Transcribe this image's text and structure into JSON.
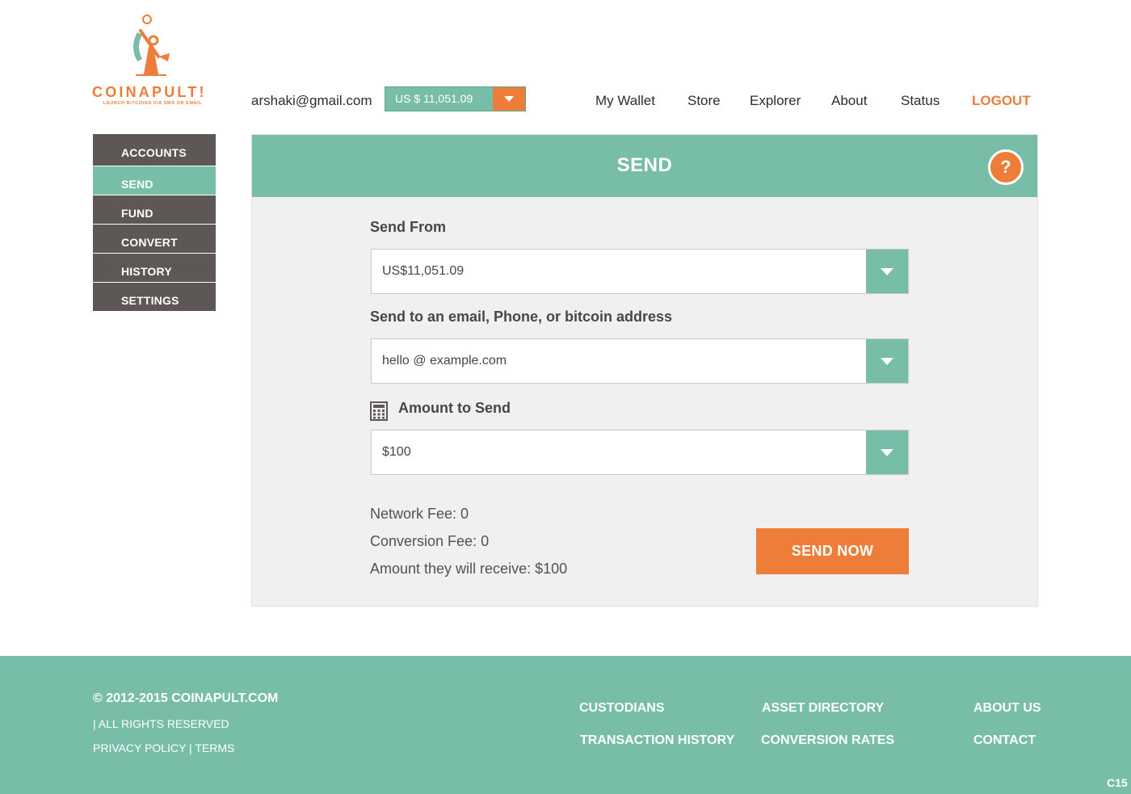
{
  "brand": {
    "name": "COINAPULT!",
    "tagline": "LAUNCH BITCOINS VIA SMS OR EMAIL",
    "accent_color": "#ee7d3a",
    "primary_color": "#78bda8"
  },
  "header": {
    "user_email": "arshaki@gmail.com",
    "balance": "US $ 11,051.09",
    "nav": [
      "My Wallet",
      "Store",
      "Explorer",
      "About",
      "Status"
    ],
    "logout": "LOGOUT"
  },
  "sidebar": {
    "items": [
      "ACCOUNTS",
      "SEND",
      "FUND",
      "CONVERT",
      "HISTORY",
      "SETTINGS"
    ],
    "active": "SEND"
  },
  "send": {
    "title": "SEND",
    "help": "?",
    "from_label": "Send From",
    "from_value": "US$11,051.09",
    "to_label": "Send to an email, Phone, or bitcoin address",
    "to_value": "hello @ example.com",
    "amount_label": "Amount to Send",
    "amount_value": "$100",
    "network_fee": "Network Fee: 0",
    "conversion_fee": "Conversion Fee: 0",
    "receive": "Amount they will receive: $100",
    "submit": "SEND NOW"
  },
  "footer": {
    "copyright": "© 2012-2015 COINAPULT.COM",
    "rights": "| ALL RIGHTS RESERVED",
    "privacy": "PRIVACY POLICY",
    "separator": "|",
    "terms": "TERMS",
    "links": {
      "custodians": "CUSTODIANS",
      "asset_directory": "ASSET DIRECTORY",
      "about_us": "ABOUT US",
      "transaction_history": "TRANSACTION HISTORY",
      "conversion_rates": "CONVERSION RATES",
      "contact": "CONTACT"
    },
    "version": "C15"
  }
}
